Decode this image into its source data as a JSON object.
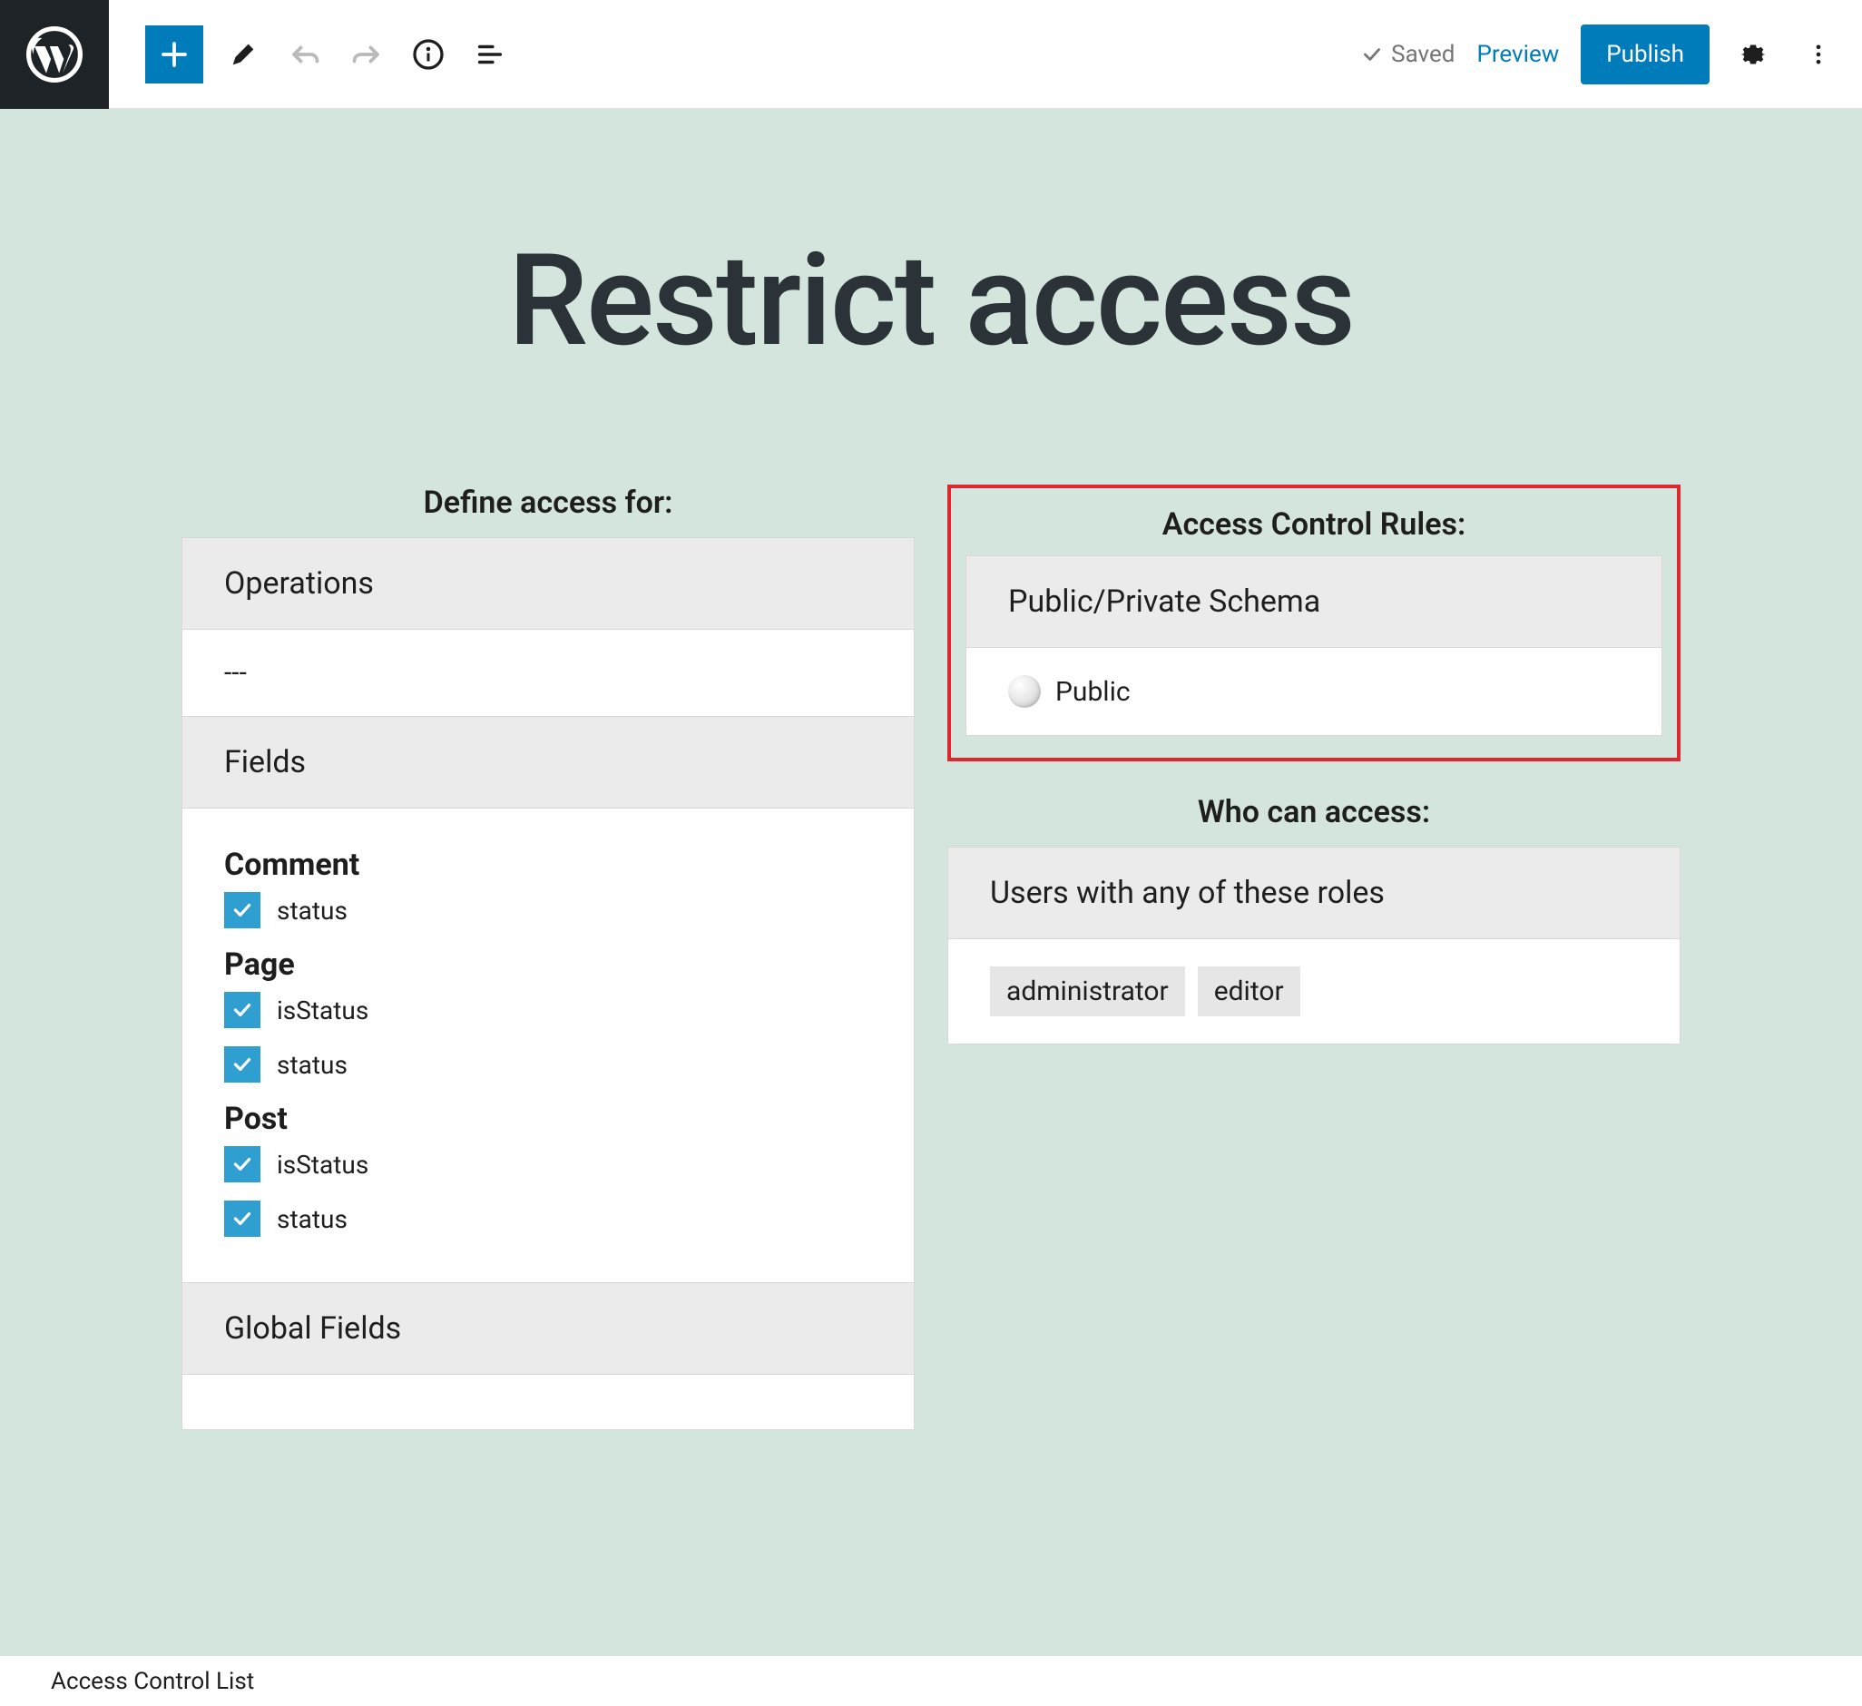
{
  "toolbar": {
    "saved_label": "Saved",
    "preview_label": "Preview",
    "publish_label": "Publish"
  },
  "page": {
    "title": "Restrict access"
  },
  "left": {
    "heading": "Define access for:",
    "operations": {
      "header": "Operations",
      "value": "---"
    },
    "fields": {
      "header": "Fields",
      "groups": [
        {
          "title": "Comment",
          "items": [
            "status"
          ]
        },
        {
          "title": "Page",
          "items": [
            "isStatus",
            "status"
          ]
        },
        {
          "title": "Post",
          "items": [
            "isStatus",
            "status"
          ]
        }
      ]
    },
    "global_fields": {
      "header": "Global Fields"
    }
  },
  "right": {
    "rules": {
      "heading": "Access Control Rules:",
      "header": "Public/Private Schema",
      "value": "Public"
    },
    "who": {
      "heading": "Who can access:",
      "header": "Users with any of these roles",
      "roles": [
        "administrator",
        "editor"
      ]
    }
  },
  "footer": {
    "text": "Access Control List"
  }
}
